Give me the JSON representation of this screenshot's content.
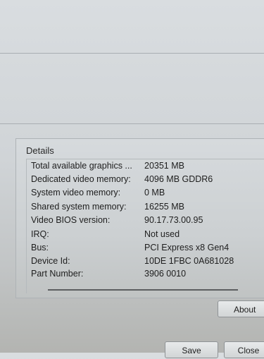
{
  "details": {
    "title": "Details",
    "rows": [
      {
        "label": "Total available graphics ...",
        "value": "20351 MB"
      },
      {
        "label": "Dedicated video memory:",
        "value": "4096 MB GDDR6"
      },
      {
        "label": "System video memory:",
        "value": "0 MB"
      },
      {
        "label": "Shared system memory:",
        "value": "16255 MB"
      },
      {
        "label": "Video BIOS version:",
        "value": "90.17.73.00.95"
      },
      {
        "label": "IRQ:",
        "value": "Not used"
      },
      {
        "label": "Bus:",
        "value": "PCI Express x8 Gen4"
      },
      {
        "label": "Device Id:",
        "value": "10DE 1FBC 0A681028"
      },
      {
        "label": "Part Number:",
        "value": "3906 0010"
      }
    ]
  },
  "buttons": {
    "about": "About",
    "save": "Save",
    "close": "Close"
  }
}
